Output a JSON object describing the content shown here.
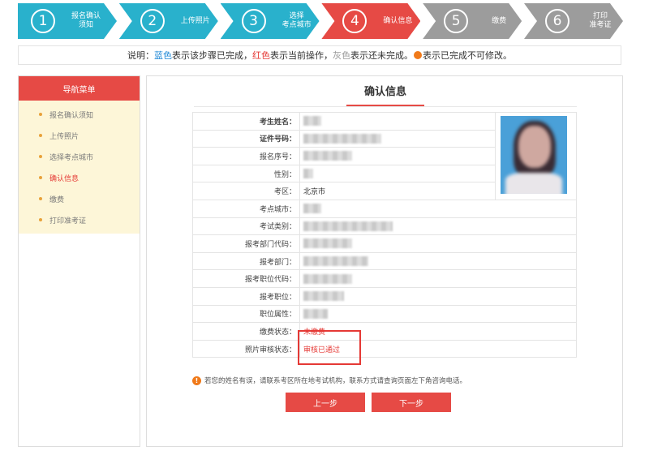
{
  "steps": [
    {
      "num": "1",
      "label": "报名确认\n须知",
      "state": "done"
    },
    {
      "num": "2",
      "label": "上传照片",
      "state": "done"
    },
    {
      "num": "3",
      "label": "选择\n考点城市",
      "state": "done"
    },
    {
      "num": "4",
      "label": "确认信息",
      "state": "current"
    },
    {
      "num": "5",
      "label": "缴费",
      "state": "todo"
    },
    {
      "num": "6",
      "label": "打印\n准考证",
      "state": "todo"
    }
  ],
  "legend": {
    "prefix": "说明：",
    "blue_word": "蓝色",
    "blue_text": "表示该步骤已完成，",
    "red_word": "红色",
    "red_text": "表示当前操作，",
    "gray_word": "灰色",
    "gray_text": "表示还未完成。",
    "lock_text": "表示已完成不可修改。"
  },
  "sidebar": {
    "title": "导航菜单",
    "items": [
      {
        "label": "报名确认须知",
        "active": false
      },
      {
        "label": "上传照片",
        "active": false
      },
      {
        "label": "选择考点城市",
        "active": false
      },
      {
        "label": "确认信息",
        "active": true
      },
      {
        "label": "缴费",
        "active": false
      },
      {
        "label": "打印准考证",
        "active": false
      }
    ]
  },
  "main": {
    "title": "确认信息",
    "rows": [
      {
        "label": "考生姓名：",
        "value": "",
        "redacted": true,
        "redact_width": 22
      },
      {
        "label": "证件号码：",
        "value": "",
        "redacted": true,
        "redact_width": 96
      },
      {
        "label": "报名序号：",
        "value": "",
        "redacted": true,
        "redact_width": 60
      },
      {
        "label": "性别：",
        "value": "",
        "redacted": true,
        "redact_width": 12
      },
      {
        "label": "考区：",
        "value": "北京市",
        "redacted": false
      },
      {
        "label": "考点城市：",
        "value": "",
        "redacted": true,
        "redact_width": 22
      },
      {
        "label": "考试类别：",
        "value": "",
        "redacted": true,
        "redact_width": 110
      },
      {
        "label": "报考部门代码：",
        "value": "",
        "redacted": true,
        "redact_width": 60
      },
      {
        "label": "报考部门：",
        "value": "",
        "redacted": true,
        "redact_width": 80
      },
      {
        "label": "报考职位代码：",
        "value": "",
        "redacted": true,
        "redact_width": 60
      },
      {
        "label": "报考职位：",
        "value": "",
        "redacted": true,
        "redact_width": 50
      },
      {
        "label": "职位属性：",
        "value": "",
        "redacted": true,
        "redact_width": 30
      },
      {
        "label": "缴费状态：",
        "value": "未缴费",
        "redacted": false,
        "status": true
      },
      {
        "label": "照片审核状态：",
        "value": "审核已通过",
        "redacted": false,
        "status": true
      }
    ],
    "notice": "若您的姓名有误，请联系考区所在地考试机构，联系方式请查询页面左下角咨询电话。",
    "prev_label": "上一步",
    "next_label": "下一步"
  },
  "colors": {
    "done": "#29b1cc",
    "current": "#e64a45",
    "todo": "#9c9c9c"
  }
}
